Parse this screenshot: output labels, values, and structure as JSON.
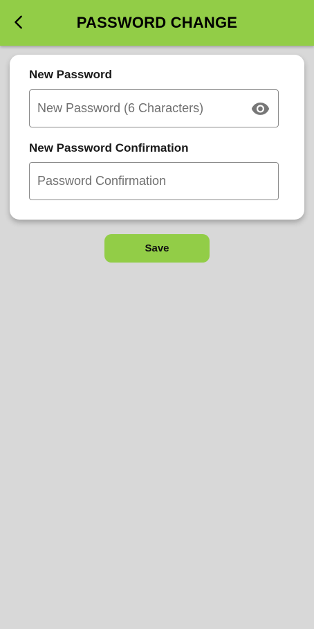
{
  "header": {
    "title": "PASSWORD CHANGE",
    "back_icon": "chevron-left-icon",
    "background_color": "#92cd47"
  },
  "form": {
    "new_password": {
      "label": "New Password",
      "placeholder": "New Password (6 Characters)",
      "value": "",
      "toggle_icon": "eye-icon"
    },
    "confirm_password": {
      "label": "New Password Confirmation",
      "placeholder": "Password Confirmation",
      "value": ""
    }
  },
  "actions": {
    "save_label": "Save",
    "save_color": "#92cd47"
  },
  "page": {
    "background_color": "#d8d8d8"
  }
}
